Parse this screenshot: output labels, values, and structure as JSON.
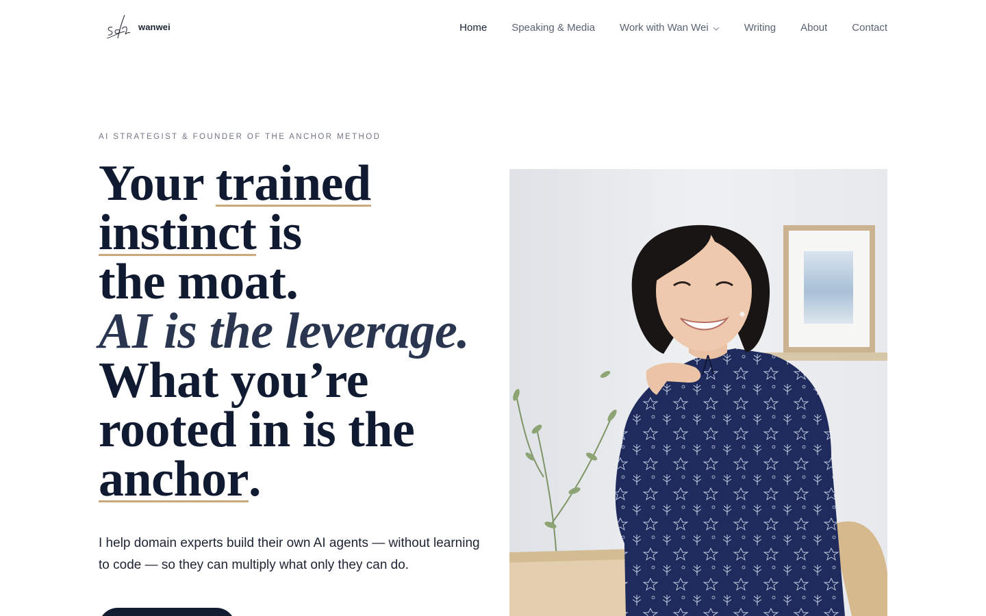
{
  "header": {
    "logo": {
      "script": "soh",
      "word": "wanwei"
    },
    "nav": [
      {
        "label": "Home",
        "active": true
      },
      {
        "label": "Speaking & Media"
      },
      {
        "label": "Work with Wan Wei",
        "has_dropdown": true
      },
      {
        "label": "Writing"
      },
      {
        "label": "About"
      },
      {
        "label": "Contact"
      }
    ]
  },
  "hero": {
    "eyebrow": "AI STRATEGIST & FOUNDER OF THE ANCHOR METHOD",
    "headline": {
      "l1a": "Your ",
      "l1b": "trained",
      "l2a": "instinct",
      "l2b": " is",
      "l3": "the moat.",
      "l4": "AI is the leverage.",
      "l5": "What you’re",
      "l6": "rooted in is the",
      "l7a": "anchor",
      "l7b": "."
    },
    "intro": "I help domain experts build their own AI agents — without learning to code — so they can multiply what only they can do."
  },
  "colors": {
    "navy": "#121c30",
    "accent_underline": "#c9a97a",
    "muted_text": "#6f7683"
  }
}
